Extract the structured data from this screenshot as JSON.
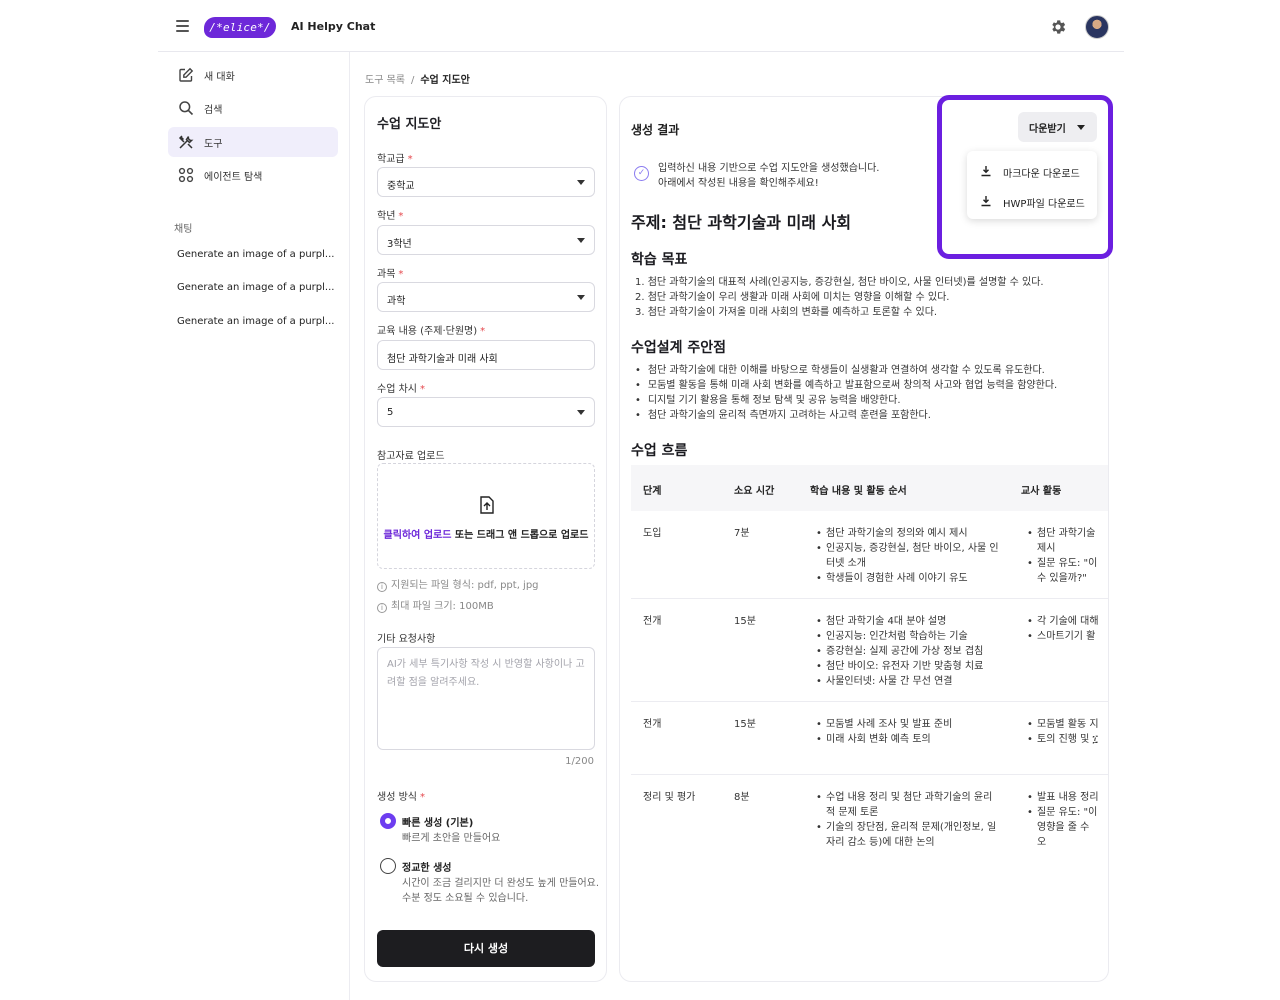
{
  "header": {
    "logo_text": "/*elice*/",
    "app_title": "AI Helpy Chat"
  },
  "sidebar": {
    "nav": [
      {
        "label": "새 대화",
        "icon": "edit-icon"
      },
      {
        "label": "검색",
        "icon": "search-icon"
      },
      {
        "label": "도구",
        "icon": "tools-icon",
        "active": true
      },
      {
        "label": "에이전트 탐색",
        "icon": "agents-icon"
      }
    ],
    "section_label": "채팅",
    "chats": [
      "Generate an image of a purpl...",
      "Generate an image of a purpl...",
      "Generate an image of a purpl..."
    ]
  },
  "breadcrumb": {
    "parent": "도구 목록",
    "separator": "/",
    "current": "수업 지도안"
  },
  "form": {
    "title": "수업 지도안",
    "school_level": {
      "label": "학교급",
      "value": "중학교"
    },
    "grade": {
      "label": "학년",
      "value": "3학년"
    },
    "subject": {
      "label": "과목",
      "value": "과학"
    },
    "content": {
      "label": "교육 내용 (주제·단원명)",
      "value": "첨단 과학기술과 미래 사회"
    },
    "session": {
      "label": "수업 차시",
      "value": "5"
    },
    "upload": {
      "label": "참고자료 업로드",
      "link_text": "클릭하여 업로드",
      "rest_text": " 또는 드래그 앤 드롭으로 업로드",
      "hint_formats": "지원되는 파일 형식: pdf, ppt, jpg",
      "hint_size": "최대 파일 크기: 100MB"
    },
    "extra": {
      "label": "기타 요청사항",
      "placeholder": "AI가 세부 특기사항 작성 시 반영할 사항이나 고려할 점을 알려주세요.",
      "counter": "1/200"
    },
    "mode": {
      "label": "생성 방식",
      "fast_title": "빠른 생성 (기본)",
      "fast_desc": "빠르게 초안을 만들어요",
      "precise_title": "정교한 생성",
      "precise_desc_1": "시간이 조금 걸리지만 더 완성도 높게 만들어요.",
      "precise_desc_2": "수분 정도 소요될 수 있습니다."
    },
    "regen_button": "다시 생성"
  },
  "result": {
    "title": "생성 결과",
    "notice_1": "입력하신 내용 기반으로 수업 지도안을 생성했습니다.",
    "notice_2": "아래에서 작성된 내용을 확인해주세요!",
    "topic": "주제: 첨단 과학기술과 미래 사회",
    "goals_heading": "학습 목표",
    "goals": [
      "1. 첨단 과학기술의 대표적 사례(인공지능, 증강현실, 첨단 바이오, 사물 인터넷)를 설명할 수 있다.",
      "2. 첨단 과학기술이 우리 생활과 미래 사회에 미치는 영향을 이해할 수 있다.",
      "3. 첨단 과학기술이 가져올 미래 사회의 변화를 예측하고 토론할 수 있다."
    ],
    "notes_heading": "수업설계 주안점",
    "notes": [
      "첨단 과학기술에 대한 이해를 바탕으로 학생들이 실생활과 연결하여 생각할 수 있도록 유도한다.",
      "모둠별 활동을 통해 미래 사회 변화를 예측하고 발표함으로써 창의적 사고와 협업 능력을 함양한다.",
      "디지털 기기 활용을 통해 정보 탐색 및 공유 능력을 배양한다.",
      "첨단 과학기술의 윤리적 측면까지 고려하는 사고력 훈련을 포함한다."
    ],
    "flow_heading": "수업 흐름",
    "columns": [
      "단계",
      "소요 시간",
      "학습 내용 및 활동 순서",
      "교사 활동"
    ],
    "rows": [
      {
        "stage": "도입",
        "time": "7분",
        "content": [
          "첨단 과학기술의 정의와 예시 제시",
          "인공지능, 증강현실, 첨단 바이오, 사물 인터넷 소개",
          "학생들이 경험한 사례 이야기 유도"
        ],
        "teacher": [
          "첨단 과학기술 제시",
          "질문 유도: \"이 수 있을까?\""
        ]
      },
      {
        "stage": "전개",
        "time": "15분",
        "content": [
          "첨단 과학기술 4대 분야 설명",
          "인공지능: 인간처럼 학습하는 기술",
          "증강현실: 실제 공간에 가상 정보 겹침",
          "첨단 바이오: 유전자 기반 맞춤형 치료",
          "사물인터넷: 사물 간 무선 연결"
        ],
        "teacher": [
          "각 기술에 대해",
          "스마트기기 활"
        ]
      },
      {
        "stage": "전개",
        "time": "15분",
        "content": [
          "모둠별 사례 조사 및 발표 준비",
          "미래 사회 변화 예측 토의"
        ],
        "teacher": [
          "모둠별 활동 지",
          "토의 진행 및 ፲"
        ]
      },
      {
        "stage": "정리 및 평가",
        "time": "8분",
        "content": [
          "수업 내용 정리 및 첨단 과학기술의 윤리적 문제 토론",
          "기술의 장단점, 윤리적 문제(개인정보, 일자리 감소 등)에 대한 논의"
        ],
        "teacher": [
          "발표 내용 정리",
          "질문 유도: \"이 영향을 줄 수 오"
        ]
      }
    ]
  },
  "download": {
    "button_label": "다운받기",
    "items": [
      {
        "label": "마크다운 다운로드",
        "icon": "download-icon"
      },
      {
        "label": "HWP파일 다운로드",
        "icon": "download-icon"
      }
    ]
  },
  "colors": {
    "accent": "#6d28d9",
    "highlight": "#6b1fe0",
    "primary_button": "#1d1d20"
  }
}
